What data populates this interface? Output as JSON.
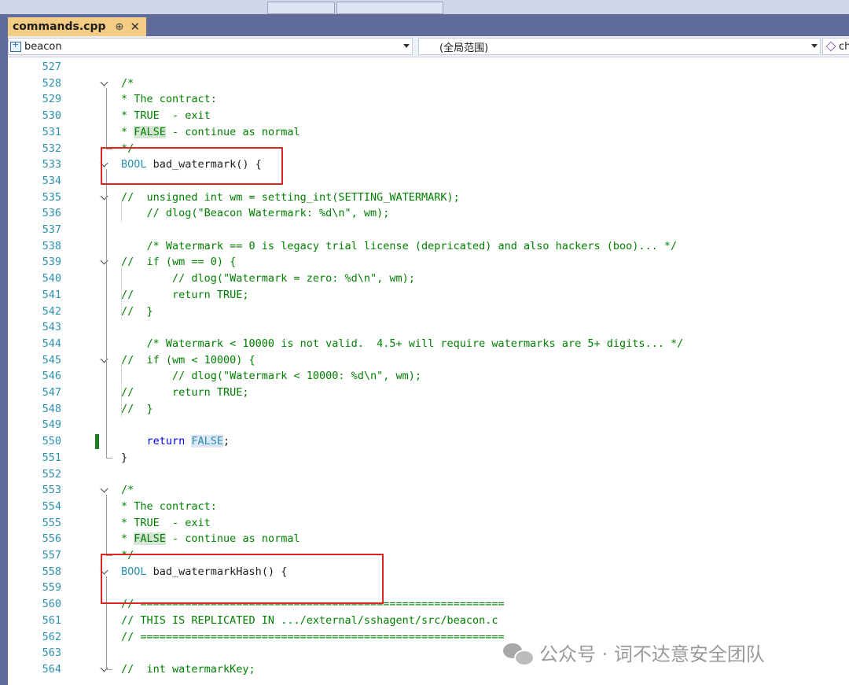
{
  "tab": {
    "filename": "commands.cpp",
    "pin_glyph": "⊕",
    "close_glyph": "✕"
  },
  "nav": {
    "project": "beacon",
    "scope": "(全局范围)",
    "member": "che"
  },
  "lines": [
    {
      "n": "527",
      "segs": []
    },
    {
      "n": "528",
      "fold": true,
      "segs": [
        {
          "t": "/*",
          "c": "cm"
        }
      ]
    },
    {
      "n": "529",
      "segs": [
        {
          "t": "* The contract:",
          "c": "cm"
        }
      ]
    },
    {
      "n": "530",
      "segs": [
        {
          "t": "* TRUE  - exit",
          "c": "cm"
        }
      ]
    },
    {
      "n": "531",
      "segs": [
        {
          "t": "* ",
          "c": "cm"
        },
        {
          "t": "FALSE",
          "c": "cm hlg"
        },
        {
          "t": " - continue as normal",
          "c": "cm"
        }
      ]
    },
    {
      "n": "532",
      "segs": [
        {
          "t": "*/",
          "c": "cm"
        }
      ]
    },
    {
      "n": "533",
      "fold": true,
      "segs": [
        {
          "t": "BOOL",
          "c": "ty"
        },
        {
          "t": " bad_watermark() {",
          "c": ""
        }
      ]
    },
    {
      "n": "534",
      "segs": []
    },
    {
      "n": "535",
      "fold": true,
      "segs": [
        {
          "t": "//  unsigned int wm = setting_int(SETTING_WATERMARK);",
          "c": "cm"
        }
      ]
    },
    {
      "n": "536",
      "segs": [
        {
          "t": "    // dlog(\"Beacon Watermark: %d\\n\", wm);",
          "c": "cm"
        }
      ]
    },
    {
      "n": "537",
      "segs": []
    },
    {
      "n": "538",
      "segs": [
        {
          "t": "    /* Watermark == 0 is legacy trial license (depricated) and also hackers (boo)... */",
          "c": "cm"
        }
      ]
    },
    {
      "n": "539",
      "fold": true,
      "segs": [
        {
          "t": "//  if (wm == 0) {",
          "c": "cm"
        }
      ]
    },
    {
      "n": "540",
      "segs": [
        {
          "t": "        // dlog(\"Watermark = zero: %d\\n\", wm);",
          "c": "cm"
        }
      ]
    },
    {
      "n": "541",
      "segs": [
        {
          "t": "//      return TRUE;",
          "c": "cm"
        }
      ]
    },
    {
      "n": "542",
      "segs": [
        {
          "t": "//  }",
          "c": "cm"
        }
      ]
    },
    {
      "n": "543",
      "segs": []
    },
    {
      "n": "544",
      "segs": [
        {
          "t": "    /* Watermark < 10000 is not valid.  4.5+ will require watermarks are 5+ digits... */",
          "c": "cm"
        }
      ]
    },
    {
      "n": "545",
      "fold": true,
      "segs": [
        {
          "t": "//  if (wm < 10000) {",
          "c": "cm"
        }
      ]
    },
    {
      "n": "546",
      "segs": [
        {
          "t": "        // dlog(\"Watermark < 10000: %d\\n\", wm);",
          "c": "cm"
        }
      ]
    },
    {
      "n": "547",
      "segs": [
        {
          "t": "//      return TRUE;",
          "c": "cm"
        }
      ]
    },
    {
      "n": "548",
      "segs": [
        {
          "t": "//  }",
          "c": "cm"
        }
      ]
    },
    {
      "n": "549",
      "segs": []
    },
    {
      "n": "550",
      "segs": [
        {
          "t": "    return ",
          "c": "kw"
        },
        {
          "t": "FALSE",
          "c": "ty hl"
        },
        {
          "t": ";",
          "c": ""
        }
      ]
    },
    {
      "n": "551",
      "segs": [
        {
          "t": "}",
          "c": ""
        }
      ]
    },
    {
      "n": "552",
      "segs": []
    },
    {
      "n": "553",
      "fold": true,
      "segs": [
        {
          "t": "/*",
          "c": "cm"
        }
      ]
    },
    {
      "n": "554",
      "segs": [
        {
          "t": "* The contract:",
          "c": "cm"
        }
      ]
    },
    {
      "n": "555",
      "segs": [
        {
          "t": "* TRUE  - exit",
          "c": "cm"
        }
      ]
    },
    {
      "n": "556",
      "segs": [
        {
          "t": "* ",
          "c": "cm"
        },
        {
          "t": "FALSE",
          "c": "cm hlg"
        },
        {
          "t": " - continue as normal",
          "c": "cm"
        }
      ]
    },
    {
      "n": "557",
      "segs": [
        {
          "t": "*/",
          "c": "cm"
        }
      ]
    },
    {
      "n": "558",
      "fold": true,
      "segs": [
        {
          "t": "BOOL",
          "c": "ty"
        },
        {
          "t": " bad_watermarkHash() {",
          "c": ""
        }
      ]
    },
    {
      "n": "559",
      "segs": []
    },
    {
      "n": "560",
      "segs": [
        {
          "t": "// =========================================================",
          "c": "cm"
        }
      ]
    },
    {
      "n": "561",
      "segs": [
        {
          "t": "// THIS IS REPLICATED IN .../external/sshagent/src/beacon.c",
          "c": "cm"
        }
      ]
    },
    {
      "n": "562",
      "segs": [
        {
          "t": "// =========================================================",
          "c": "cm"
        }
      ]
    },
    {
      "n": "563",
      "segs": []
    },
    {
      "n": "564",
      "fold": true,
      "segs": [
        {
          "t": "//  int watermarkKey;",
          "c": "cm"
        }
      ]
    }
  ],
  "watermark": {
    "text": "公众号 · 词不达意安全团队"
  }
}
